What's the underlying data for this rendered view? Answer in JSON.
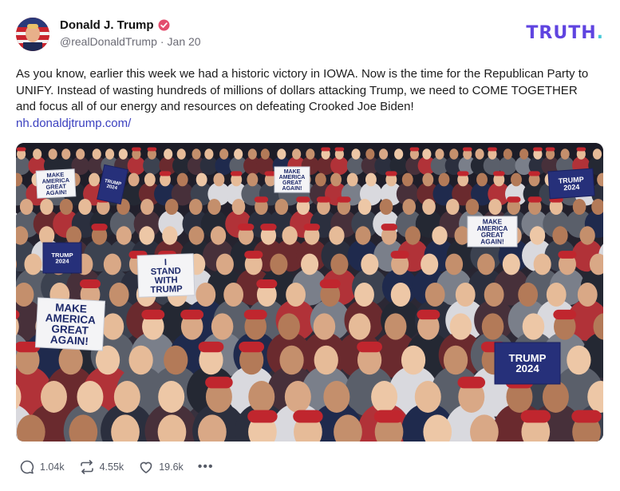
{
  "post": {
    "display_name": "Donald J. Trump",
    "handle": "@realDonaldTrump",
    "date": "Jan 20",
    "text": "As you know, earlier this week we had a historic victory in IOWA. Now is the time for the Republican Party to UNIFY. Instead of wasting hundreds of millions of dollars attacking Trump, we need to COME TOGETHER and focus all of our energy and resources on defeating Crooked Joe Biden!",
    "link": "nh.donaldjtrump.com/"
  },
  "brand": {
    "name": "TRUTH",
    "dot": ".",
    "color": "#5f44e0",
    "dot_color": "#46c9d8"
  },
  "media": {
    "signs": [
      "MAKE AMERICA GREAT AGAIN!",
      "TRUMP 2024",
      "I STAND WITH TRUMP",
      "TRUMP 2024",
      "MAKE AMERICA GREAT AGAIN!",
      "MAKE AMERICA GREAT AGAIN!",
      "TRUMP 2024",
      "MAKE AMERICA GREAT AGAIN!",
      "TRUMP 2024"
    ]
  },
  "actions": {
    "replies": "1.04k",
    "retruths": "4.55k",
    "likes": "19.6k",
    "more": "•••"
  },
  "icons": [
    "verified-icon",
    "reply-icon",
    "retruth-icon",
    "like-icon",
    "more-icon"
  ]
}
